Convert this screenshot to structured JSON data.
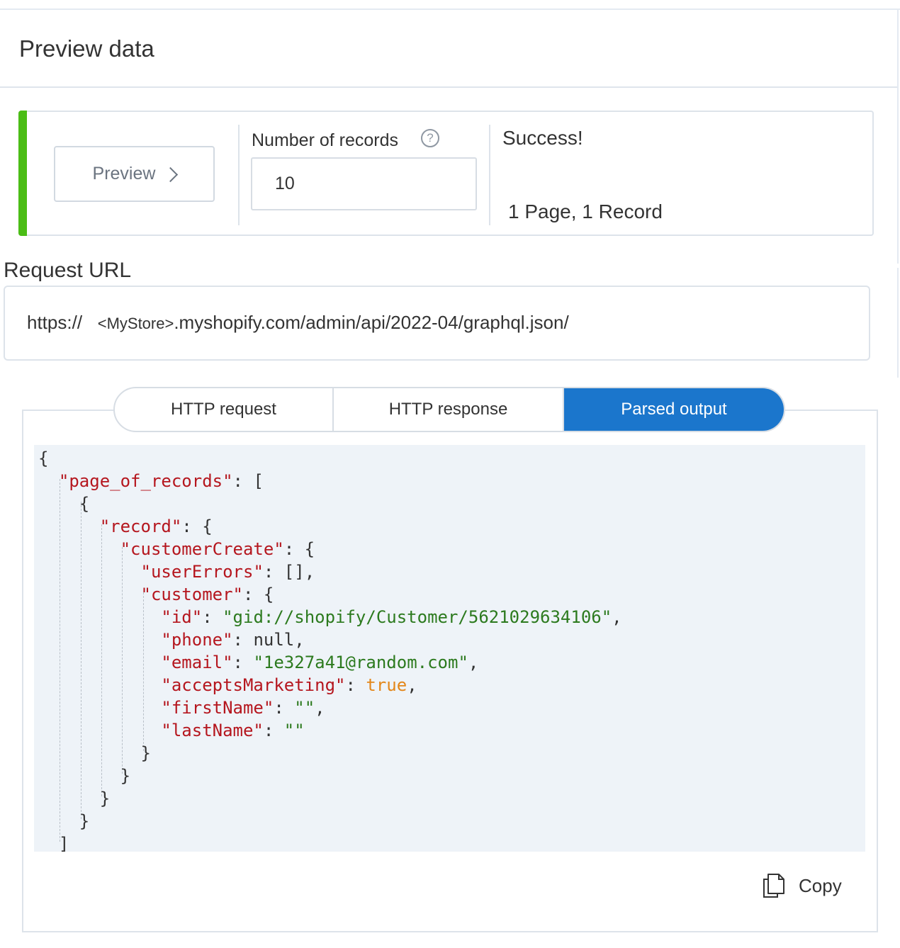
{
  "header": {
    "title": "Preview data"
  },
  "preview": {
    "button_label": "Preview",
    "records_label": "Number of records",
    "records_value": "10",
    "status": "Success!",
    "summary": "1 Page, 1 Record",
    "status_color": "#4bbd16"
  },
  "request": {
    "label": "Request URL",
    "url_prefix": "https://",
    "url_placeholder": "<MyStore>",
    "url_suffix": ".myshopify.com/admin/api/2022-04/graphql.json/"
  },
  "tabs": [
    {
      "label": "HTTP request",
      "active": false
    },
    {
      "label": "HTTP response",
      "active": false
    },
    {
      "label": "Parsed output",
      "active": true
    }
  ],
  "output": {
    "keys": {
      "page_of_records": "\"page_of_records\"",
      "record": "\"record\"",
      "customerCreate": "\"customerCreate\"",
      "userErrors": "\"userErrors\"",
      "customer": "\"customer\"",
      "id": "\"id\"",
      "phone": "\"phone\"",
      "email": "\"email\"",
      "acceptsMarketing": "\"acceptsMarketing\"",
      "firstName": "\"firstName\"",
      "lastName": "\"lastName\""
    },
    "values": {
      "id": "\"gid://shopify/Customer/5621029634106\"",
      "phone": "null",
      "email": "\"1e327a41@random.com\"",
      "acceptsMarketing": "true",
      "firstName": "\"\"",
      "lastName": "\"\""
    },
    "copy_label": "Copy"
  },
  "colors": {
    "accent": "#1b76cc",
    "json_key": "#b5161e",
    "json_string": "#2c7a1e",
    "json_bool": "#e3871a"
  }
}
